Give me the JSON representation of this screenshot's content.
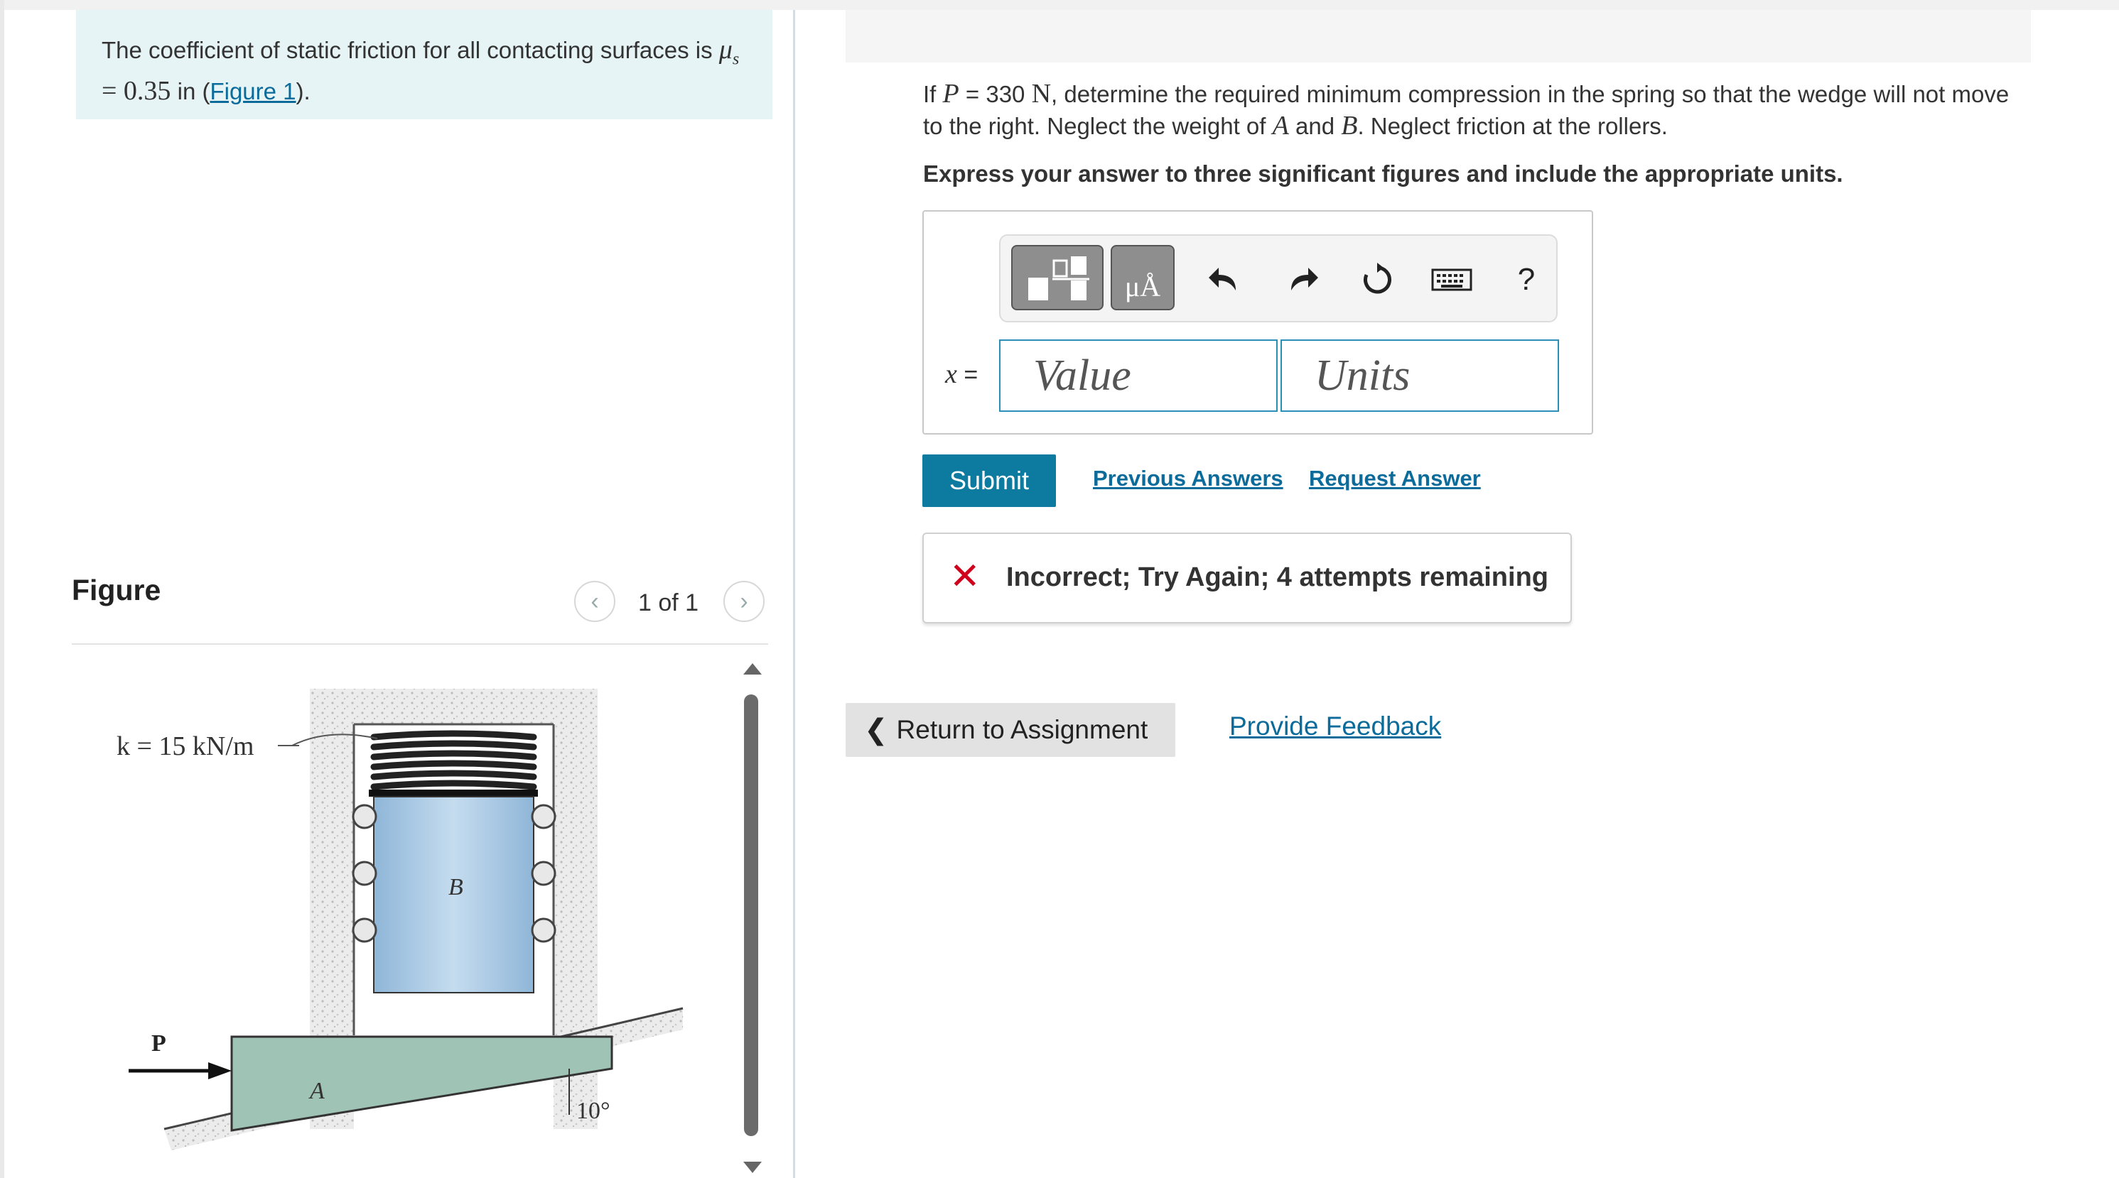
{
  "problem": {
    "text_before": "The coefficient of static friction for all contacting surfaces is",
    "mu_symbol": "μ",
    "mu_subscript": "s",
    "equals_value": "= 0.35",
    "text_in": "in (",
    "figure_link": "Figure 1",
    "text_after": ")."
  },
  "figure": {
    "title": "Figure",
    "pager_text": "1 of 1",
    "prev_icon": "chevron-left-icon",
    "next_icon": "chevron-right-icon",
    "label_k": "k = 15 kN/m",
    "label_b": "B",
    "label_a": "A",
    "label_p": "P",
    "label_angle": "10°"
  },
  "question": {
    "intro": "If",
    "p_var": "P",
    "p_value": "= 330",
    "p_unit": "N",
    "line1_rest": ", determine the required minimum compression in the spring so that the wedge will not",
    "line2_start": "move to the right. Neglect the weight of",
    "var_a": "A",
    "and_text": "and",
    "var_b": "B",
    "line2_end": ". Neglect friction at the rollers.",
    "instruction": "Express your answer to three significant figures and include the appropriate units."
  },
  "answer": {
    "toolbar": {
      "template_icon": "templates-icon",
      "units_symbol": "μÅ",
      "undo_icon": "undo-icon",
      "redo_icon": "redo-icon",
      "reset_icon": "reset-icon",
      "keyboard_icon": "keyboard-icon",
      "help_label": "?"
    },
    "variable": "x",
    "equals": "=",
    "value_placeholder": "Value",
    "units_placeholder": "Units"
  },
  "actions": {
    "submit": "Submit",
    "previous_answers": "Previous Answers",
    "request_answer": "Request Answer"
  },
  "feedback": {
    "status_icon": "x-mark-icon",
    "message": "Incorrect; Try Again; 4 attempts remaining",
    "color": "#d0021b"
  },
  "footer": {
    "return_label": "Return to Assignment",
    "provide_feedback": "Provide Feedback"
  },
  "colors": {
    "primary": "#0d7aa0",
    "link": "#0b6b9a",
    "info_bg": "#e6f4f5",
    "error": "#d0021b"
  }
}
